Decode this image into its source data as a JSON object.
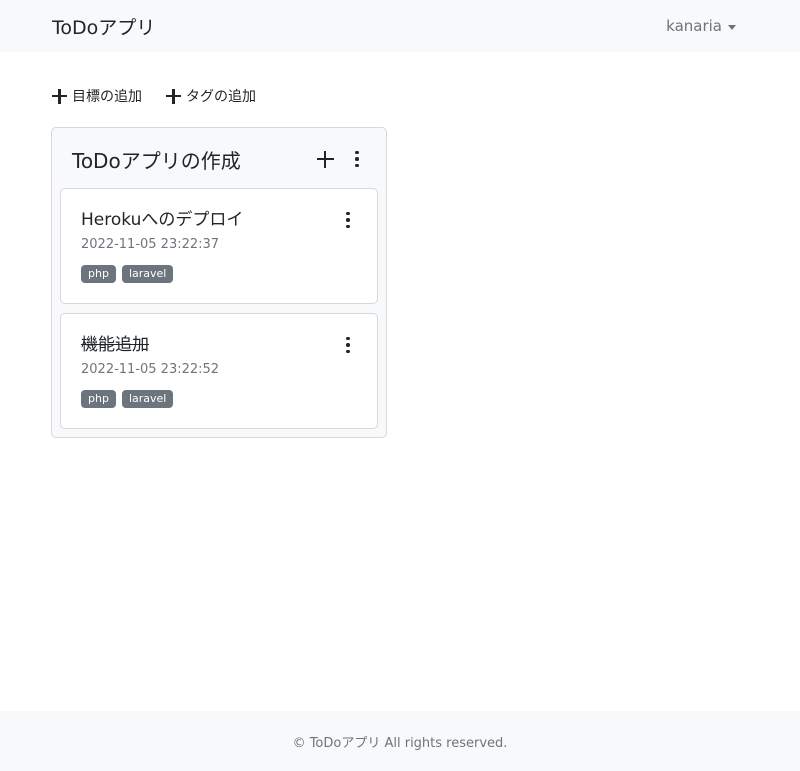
{
  "navbar": {
    "brand": "ToDoアプリ",
    "user": "kanaria"
  },
  "actions": {
    "add_goal": "目標の追加",
    "add_tag": "タグの追加"
  },
  "goal": {
    "title": "ToDoアプリの作成",
    "todos": [
      {
        "title": "Herokuへのデプロイ",
        "date": "2022-11-05 23:22:37",
        "done": false,
        "tags": [
          "php",
          "laravel"
        ]
      },
      {
        "title": "機能追加",
        "date": "2022-11-05 23:22:52",
        "done": true,
        "tags": [
          "php",
          "laravel"
        ]
      }
    ]
  },
  "footer": {
    "text": "© ToDoアプリ All rights reserved."
  },
  "colors": {
    "navbar_bg": "#f8f9fa",
    "tag_bg": "#6c757d",
    "muted_text": "#6c757d"
  }
}
